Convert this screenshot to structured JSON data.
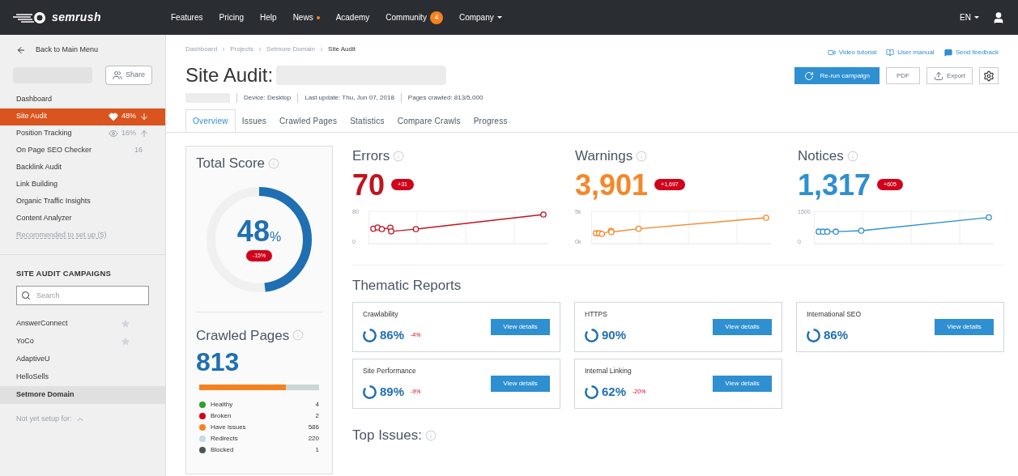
{
  "topbar": {
    "logo": "semrush",
    "nav": [
      {
        "label": "Features",
        "kind": "plain"
      },
      {
        "label": "Pricing",
        "kind": "plain"
      },
      {
        "label": "Help",
        "kind": "plain"
      },
      {
        "label": "News",
        "kind": "dot"
      },
      {
        "label": "Academy",
        "kind": "plain"
      },
      {
        "label": "Community",
        "kind": "badge",
        "badge": "4"
      },
      {
        "label": "Company",
        "kind": "caret"
      }
    ],
    "language": "EN"
  },
  "sidebar": {
    "back": "Back to Main Menu",
    "share": "Share",
    "items": [
      {
        "label": "Dashboard",
        "kind": "plain",
        "selected": false
      },
      {
        "label": "Site Audit",
        "kind": "score",
        "metric": "48%",
        "rising": false,
        "selected": true
      },
      {
        "label": "Position Tracking",
        "kind": "tracking",
        "metric": "16%",
        "rising": true,
        "selected": false
      },
      {
        "label": "On Page SEO Checker",
        "kind": "count",
        "metric": "16",
        "selected": false
      },
      {
        "label": "Backlink Audit",
        "kind": "plain",
        "selected": false
      },
      {
        "label": "Link Building",
        "kind": "plain",
        "selected": false
      },
      {
        "label": "Organic Traffic Insights",
        "kind": "plain",
        "selected": false
      },
      {
        "label": "Content Analyzer",
        "kind": "plain",
        "selected": false
      },
      {
        "label": "Recommended to set up (5)",
        "kind": "link",
        "selected": false
      }
    ],
    "campaigns_title": "SITE AUDIT CAMPAIGNS",
    "search": {
      "placeholder": "Search"
    },
    "campaigns": [
      {
        "label": "AnswerConnect",
        "starred": true,
        "selected": false
      },
      {
        "label": "YoCo",
        "starred": true,
        "selected": false
      },
      {
        "label": "AdaptiveU",
        "starred": false,
        "selected": false
      },
      {
        "label": "HelloSells",
        "starred": false,
        "selected": false
      },
      {
        "label": "Setmore Domain",
        "starred": false,
        "selected": true
      }
    ],
    "footer": "Not yet setup for:"
  },
  "breadcrumbs": [
    "Dashboard",
    "Projects",
    "Setmore Domain",
    "Site Audit"
  ],
  "help_links": [
    {
      "label": "Video tutorial",
      "kind": "video"
    },
    {
      "label": "User manual",
      "kind": "manual"
    },
    {
      "label": "Send feedback",
      "kind": "feedback"
    }
  ],
  "title": "Site Audit:",
  "meta": [
    "Device: Desktop",
    "Last update: Thu, Jun 07, 2018",
    "Pages crawled: 813/5,000"
  ],
  "actions": {
    "rerun": "Re-run campaign",
    "pdf": "PDF",
    "export": "Export"
  },
  "tabs": [
    {
      "label": "Overview",
      "selected": true
    },
    {
      "label": "Issues",
      "selected": false
    },
    {
      "label": "Crawled Pages",
      "selected": false
    },
    {
      "label": "Statistics",
      "selected": false
    },
    {
      "label": "Compare Crawls",
      "selected": false
    },
    {
      "label": "Progress",
      "selected": false
    }
  ],
  "total_score": {
    "title": "Total Score",
    "value": "48",
    "unit": "%",
    "change": "-15%",
    "level": 0.48
  },
  "crawled": {
    "title": "Crawled Pages",
    "value": "813",
    "level": 0.72,
    "legend": [
      {
        "label": "Healthy",
        "count": "4",
        "color": "#2ca02c"
      },
      {
        "label": "Broken",
        "count": "2",
        "color": "#d0021b"
      },
      {
        "label": "Have issues",
        "count": "586",
        "color": "#f58220"
      },
      {
        "label": "Redirects",
        "count": "220",
        "color": "#c2dbe6"
      },
      {
        "label": "Blocked",
        "count": "1",
        "color": "#4b5556"
      }
    ]
  },
  "metrics": [
    {
      "title": "Errors",
      "value": "70",
      "change": "+31",
      "color": "#c0141f",
      "y_max": "80",
      "y_min": "0"
    },
    {
      "title": "Warnings",
      "value": "3,901",
      "change": "+1,697",
      "color": "#f5872a",
      "y_max": "5k",
      "y_min": "0k"
    },
    {
      "title": "Notices",
      "value": "1,317",
      "change": "+605",
      "color": "#2e8fd1",
      "y_max": "1500",
      "y_min": "0"
    }
  ],
  "thematic_title": "Thematic Reports",
  "reports": [
    {
      "title": "Crawlability",
      "value": "86%",
      "change": "-4%",
      "button": "View details"
    },
    {
      "title": "HTTPS",
      "value": "90%",
      "button": "View details"
    },
    {
      "title": "International SEO",
      "value": "86%",
      "button": "View details"
    },
    {
      "title": "Site Performance",
      "value": "89%",
      "change": "-9%",
      "button": "View details"
    },
    {
      "title": "Internal Linking",
      "value": "62%",
      "change": "-20%",
      "button": "View details"
    }
  ],
  "top_issues": "Top Issues:"
}
